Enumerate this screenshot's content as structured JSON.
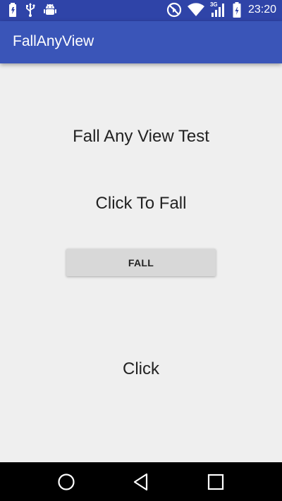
{
  "status_bar": {
    "time": "23:20",
    "network_label": "3G",
    "icons": [
      "battery-saver-icon",
      "usb-icon",
      "android-debug-icon",
      "do-not-disturb-icon",
      "wifi-icon",
      "signal-icon",
      "battery-charging-icon"
    ]
  },
  "app_bar": {
    "title": "FallAnyView"
  },
  "main": {
    "heading": "Fall Any View Test",
    "subheading": "Click To Fall",
    "fall_button_label": "FALL",
    "bottom_text": "Click"
  },
  "nav_bar": {
    "icons": [
      "back-icon",
      "home-icon",
      "recents-icon"
    ]
  },
  "colors": {
    "status_bar": "#2f44a8",
    "app_bar": "#3a55b8",
    "background": "#efefef",
    "button": "#d8d8d8"
  }
}
